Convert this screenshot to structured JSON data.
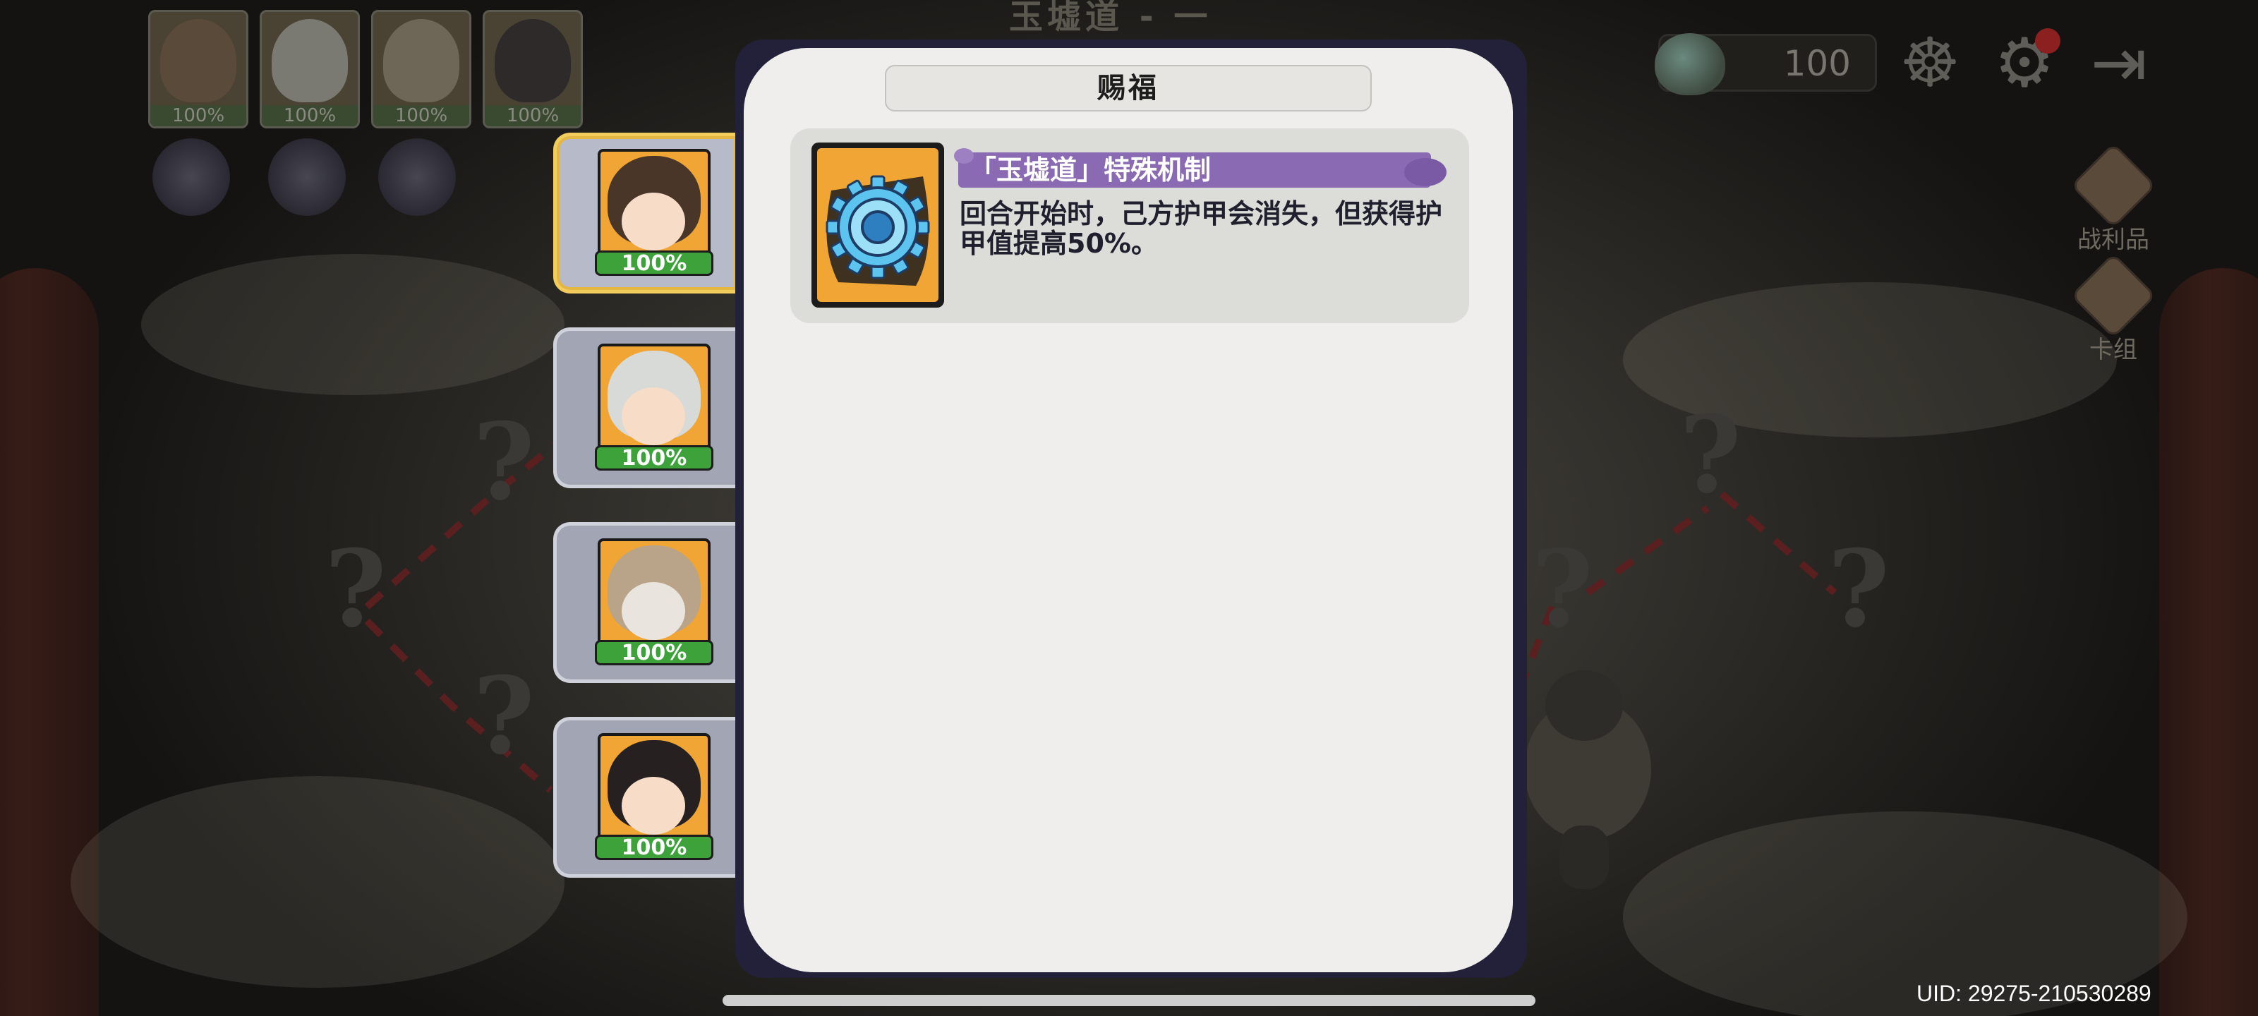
{
  "scene": {
    "title": "玉墟道 - 一层",
    "currency_value": "100",
    "side_buttons": [
      {
        "label": "战利品",
        "icon": "loot-icon"
      },
      {
        "label": "卡组",
        "icon": "deck-icon"
      }
    ],
    "hud_icons": [
      "mask-icon",
      "gear-icon",
      "exit-icon"
    ],
    "team": [
      {
        "pct": "100%"
      },
      {
        "pct": "100%"
      },
      {
        "pct": "100%"
      },
      {
        "pct": "100%"
      }
    ],
    "uid": "UID: 29275-210530289"
  },
  "roster": [
    {
      "pct": "100%",
      "selected": true
    },
    {
      "pct": "100%",
      "selected": false
    },
    {
      "pct": "100%",
      "selected": false
    },
    {
      "pct": "100%",
      "selected": false
    }
  ],
  "modal": {
    "title": "赐福",
    "blessing": {
      "icon": "gear-icon",
      "title": "「玉墟道」特殊机制",
      "description": "回合开始时，己方护甲会消失，但获得护甲值提高50%。"
    }
  },
  "colors": {
    "blessing_title_bar": "#8a6ab2",
    "hp_bar": "#3da23a",
    "selected_border": "#f2cc5c",
    "card_background": "#f0a534"
  }
}
